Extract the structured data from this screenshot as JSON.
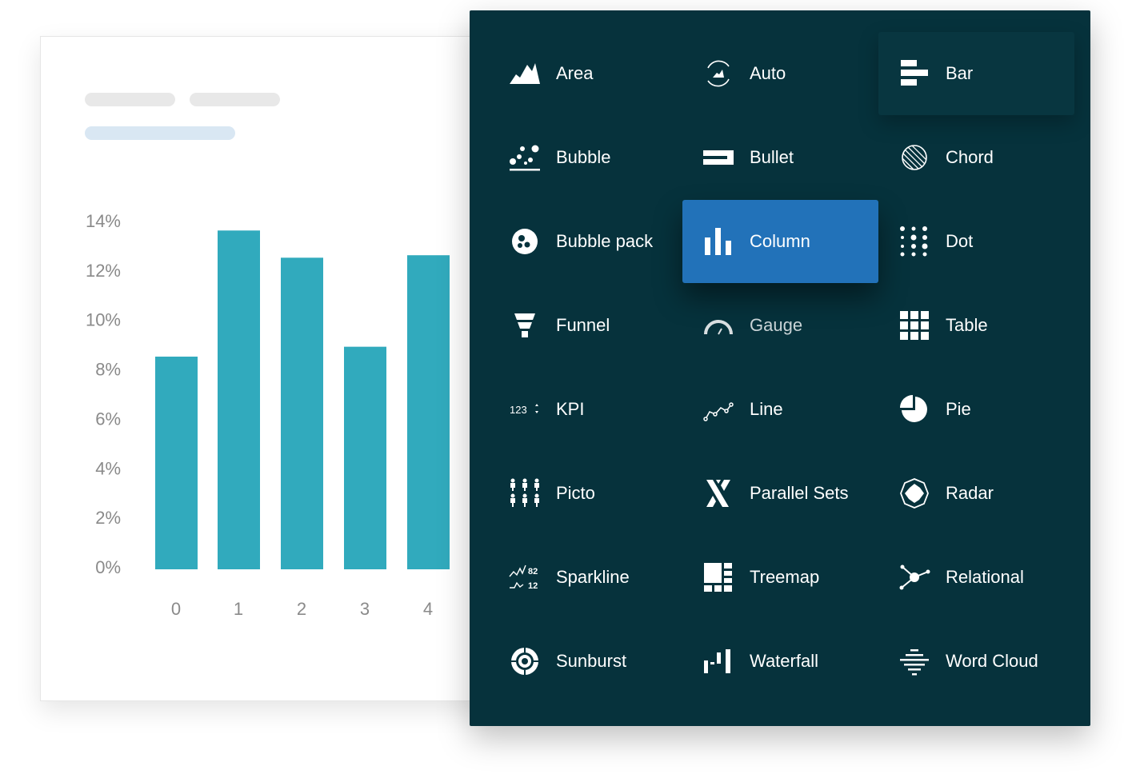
{
  "colors": {
    "panel_bg": "#06323c",
    "selected_bg": "#2272b9",
    "bar_fill": "#31aabd",
    "placeholder_gray": "#e8e8e8",
    "placeholder_blue": "#d9e7f3"
  },
  "chart_data": {
    "type": "bar",
    "categories": [
      "0",
      "1",
      "2",
      "3",
      "4"
    ],
    "values": [
      8.6,
      13.7,
      12.6,
      9.0,
      12.7
    ],
    "yticks": [
      "0%",
      "2%",
      "4%",
      "6%",
      "8%",
      "10%",
      "12%",
      "14%"
    ],
    "ylim": [
      0,
      14
    ],
    "title": "",
    "xlabel": "",
    "ylabel": "",
    "grid": false
  },
  "chart_types": {
    "selected": "Column",
    "items": [
      {
        "label": "Area",
        "icon": "area-icon"
      },
      {
        "label": "Auto",
        "icon": "auto-icon"
      },
      {
        "label": "Bar",
        "icon": "bar-icon"
      },
      {
        "label": "Bubble",
        "icon": "bubble-icon"
      },
      {
        "label": "Bullet",
        "icon": "bullet-icon"
      },
      {
        "label": "Chord",
        "icon": "chord-icon"
      },
      {
        "label": "Bubble pack",
        "icon": "bubble-pack-icon"
      },
      {
        "label": "Column",
        "icon": "column-icon"
      },
      {
        "label": "Dot",
        "icon": "dot-icon"
      },
      {
        "label": "Funnel",
        "icon": "funnel-icon"
      },
      {
        "label": "Gauge",
        "icon": "gauge-icon"
      },
      {
        "label": "Table",
        "icon": "table-icon"
      },
      {
        "label": "KPI",
        "icon": "kpi-icon",
        "icon_text": "123"
      },
      {
        "label": "Line",
        "icon": "line-icon"
      },
      {
        "label": "Pie",
        "icon": "pie-icon"
      },
      {
        "label": "Picto",
        "icon": "picto-icon"
      },
      {
        "label": "Parallel Sets",
        "icon": "parallel-sets-icon"
      },
      {
        "label": "Radar",
        "icon": "radar-icon"
      },
      {
        "label": "Sparkline",
        "icon": "sparkline-icon",
        "icon_text": [
          "82",
          "12"
        ]
      },
      {
        "label": "Treemap",
        "icon": "treemap-icon"
      },
      {
        "label": "Relational",
        "icon": "relational-icon"
      },
      {
        "label": "Sunburst",
        "icon": "sunburst-icon"
      },
      {
        "label": "Waterfall",
        "icon": "waterfall-icon"
      },
      {
        "label": "Word Cloud",
        "icon": "word-cloud-icon"
      }
    ]
  }
}
